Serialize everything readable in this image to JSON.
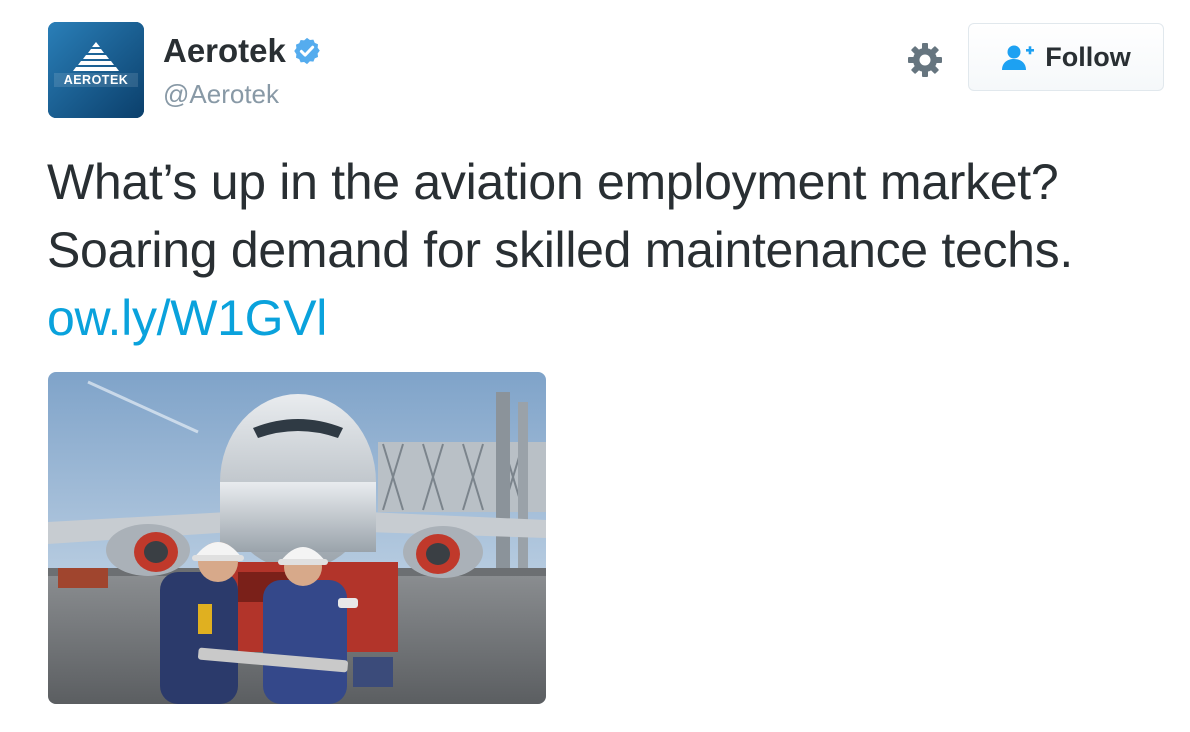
{
  "author": {
    "display_name": "Aerotek",
    "handle": "@Aerotek",
    "verified": true,
    "avatar_logo_text": "AEROTEK",
    "avatar_color": "#1a5f94"
  },
  "actions": {
    "settings_icon": "gear-icon",
    "follow_label": "Follow",
    "follow_icon": "add-user-icon"
  },
  "tweet": {
    "text": "What’s up in the aviation employment market? Soaring demand for skilled maintenance techs.",
    "link_text": "ow.ly/W1GVl"
  },
  "media": {
    "kind": "photo",
    "subject": "photo-airplane-maintenance-technicians"
  },
  "colors": {
    "link": "#0aa2dc",
    "verified_badge": "#55acee",
    "text": "#292f33",
    "muted": "#8899a6"
  }
}
